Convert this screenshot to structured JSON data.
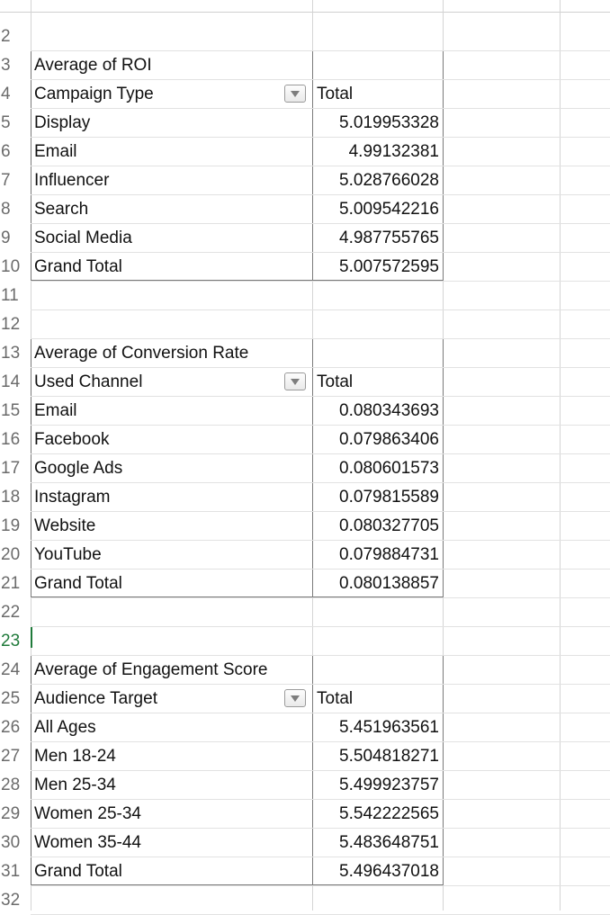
{
  "sheet": {
    "rows": [
      {
        "num": "2"
      },
      {
        "num": "3",
        "label": "Average of ROI"
      },
      {
        "num": "4",
        "label": "Campaign Type",
        "total": "Total",
        "filter": true
      },
      {
        "num": "5",
        "label": "Display",
        "value": "5.019953328"
      },
      {
        "num": "6",
        "label": "Email",
        "value": "4.99132381"
      },
      {
        "num": "7",
        "label": "Influencer",
        "value": "5.028766028"
      },
      {
        "num": "8",
        "label": "Search",
        "value": "5.009542216"
      },
      {
        "num": "9",
        "label": "Social Media",
        "value": "4.987755765"
      },
      {
        "num": "10",
        "label": "Grand Total",
        "value": "5.007572595"
      },
      {
        "num": "11"
      },
      {
        "num": "12"
      },
      {
        "num": "13",
        "label": "Average of Conversion Rate"
      },
      {
        "num": "14",
        "label": "Used Channel",
        "total": "Total",
        "filter": true
      },
      {
        "num": "15",
        "label": "Email",
        "value": "0.080343693"
      },
      {
        "num": "16",
        "label": "Facebook",
        "value": "0.079863406"
      },
      {
        "num": "17",
        "label": "Google Ads",
        "value": "0.080601573"
      },
      {
        "num": "18",
        "label": "Instagram",
        "value": "0.079815589"
      },
      {
        "num": "19",
        "label": "Website",
        "value": "0.080327705"
      },
      {
        "num": "20",
        "label": "YouTube",
        "value": "0.079884731"
      },
      {
        "num": "21",
        "label": "Grand Total",
        "value": "0.080138857"
      },
      {
        "num": "22"
      },
      {
        "num": "23",
        "active": true
      },
      {
        "num": "24",
        "label": "Average of Engagement Score"
      },
      {
        "num": "25",
        "label": "Audience Target",
        "total": "Total",
        "filter": true
      },
      {
        "num": "26",
        "label": "All Ages",
        "value": "5.451963561"
      },
      {
        "num": "27",
        "label": "Men 18-24",
        "value": "5.504818271"
      },
      {
        "num": "28",
        "label": "Men 25-34",
        "value": "5.499923757"
      },
      {
        "num": "29",
        "label": "Women 25-34",
        "value": "5.542222565"
      },
      {
        "num": "30",
        "label": "Women 35-44",
        "value": "5.483648751"
      },
      {
        "num": "31",
        "label": "Grand Total",
        "value": "5.496437018"
      },
      {
        "num": "32"
      }
    ]
  },
  "colors": {
    "gridline": "#d4d4d4",
    "pivot_border": "#7a7a7a",
    "active_row_number": "#1f7a3a"
  },
  "icons": {
    "filter_dropdown": "chevron-down-icon"
  }
}
